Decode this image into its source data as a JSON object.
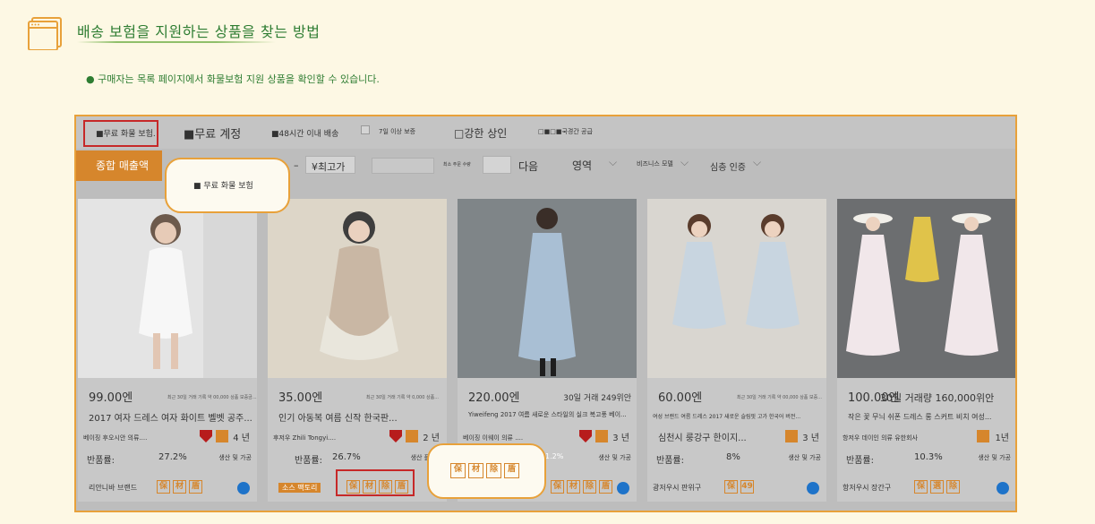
{
  "header": {
    "title": "배송 보험을 지원하는 상품을 찾는 방법"
  },
  "note": "● 구매자는 목록 페이지에서 화물보험 지원 상품을 확인할 수 있습니다.",
  "filters": {
    "free_shipping_insurance": "■무료 화물 보험.",
    "free_account": "■무료 계정",
    "ship_48h": "■48시간 이내 배송",
    "return_7day": "7일 이상 보증",
    "strong_merchant": "□강한 상인",
    "cross_border": "□■□■국경간 공급"
  },
  "sortbar": {
    "sort_label": "종합 매출액",
    "dash": "–",
    "max_price": "¥최고가",
    "min_order": "최소 주문 수량",
    "next": "다음",
    "region": "영역",
    "business_model": "비즈니스 모델",
    "deep_cert": "심층 인증"
  },
  "callouts": {
    "filter_hint": "■ 무료 화물 보험",
    "badge_hint_icons": [
      "保",
      "材",
      "除",
      "盾"
    ]
  },
  "products": [
    {
      "price": "99.00엔",
      "sales": "",
      "small_meta": "최근 30일 거래 기록 약 00,000 상품 보증금...",
      "title": "2017 여자 드레스 여자 화이트 벨벳 공주...",
      "seller": "베이징 후오시안 의류....",
      "years": "4 년",
      "return_label": "반품률:",
      "return_rate": "27.2%",
      "production": "생산 및 가공",
      "brand": "리안니바 브랜드",
      "badges": [
        "保",
        "材",
        "盾"
      ]
    },
    {
      "price": "35.00엔",
      "sales": "",
      "small_meta": "최근 30일 거래 기록 약 0,000 상품...",
      "title": "인기 아동복 여름 신작 한국판...",
      "seller": "후저우 Zhili Tongyi....",
      "years": "2 년",
      "return_label": "반품률:",
      "return_rate": "26.7%",
      "production": "생산 플러스",
      "brand": "소스 팩토리",
      "badges": [
        "保",
        "材",
        "除",
        "盾"
      ]
    },
    {
      "price": "220.00엔",
      "sales": "30일 거래 249위안",
      "small_meta": "",
      "title": "Yiweifeng 2017 여름 새로운 스타일의 실크 복고풍 베이...",
      "seller": "베이징 이웨이 의류 ....",
      "years": "3 년",
      "return_label": "",
      "return_rate": "1.2%",
      "production": "생산 및 가공",
      "brand": "",
      "badges": [
        "保",
        "材",
        "除",
        "盾"
      ]
    },
    {
      "price": "60.00엔",
      "sales": "",
      "small_meta": "최근 30일 거래 기록 약 00,000 상품 보증...",
      "title": "심천시 룽강구 한이지...",
      "seller": "여성 브랜드 여름 드레스 2017 새로운 슬림핏 고가 한국어 버전...",
      "years": "3 년",
      "return_label": "반품률:",
      "return_rate": "8%",
      "production": "생산 및 가공",
      "brand": "광저우시 판위구",
      "badges": [
        "保",
        "49"
      ]
    },
    {
      "price": "100.00엔",
      "sales": "30일 거래량 160,000위안",
      "small_meta": "",
      "title": "작은 꽃 무늬 쉬폰 드레스 롱 스커트 비치 여성...",
      "seller": "항저우 데이인 의류 유한회사",
      "years": "1년",
      "return_label": "반품률:",
      "return_rate": "10.3%",
      "production": "생산 및 가공",
      "brand": "항저우시 장간구",
      "badges": [
        "保",
        "選",
        "除"
      ]
    }
  ]
}
